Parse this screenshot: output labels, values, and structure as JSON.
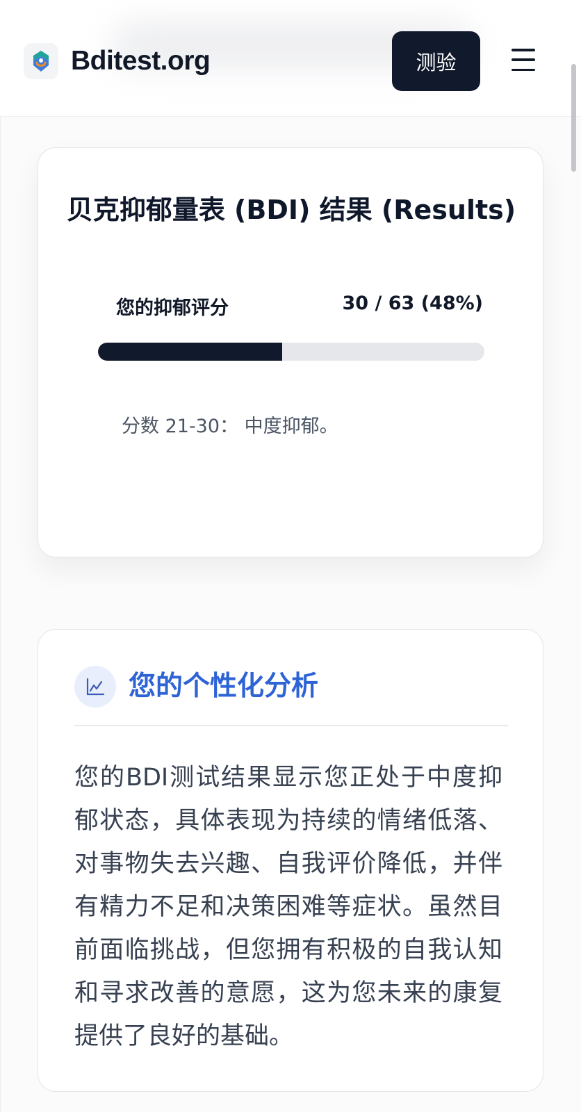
{
  "header": {
    "brand": "Bditest.org",
    "logo_icon": "brain-logo-icon",
    "test_button_label": "测验",
    "menu_icon": "hamburger-menu-icon"
  },
  "results": {
    "title": "贝克抑郁量表 (BDI) 结果 (Results)",
    "score_label": "您的抑郁评分",
    "score_text": "30 / 63 (48%)",
    "score": 30,
    "max_score": 63,
    "progress_fraction": 0.476,
    "description": "分数 21-30：  中度抑郁。"
  },
  "analysis": {
    "icon": "line-chart-icon",
    "title": "您的个性化分析",
    "body": "您的BDI测试结果显示您正处于中度抑郁状态，具体表现为持续的情绪低落、对事物失去兴趣、自我评价降低，并伴有精力不足和决策困难等症状。虽然目前面临挑战，但您拥有积极的自我认知和寻求改善的意愿，这为您未来的康复提供了良好的基础。"
  },
  "colors": {
    "primary_dark": "#111a2c",
    "accent_blue": "#2e63d6",
    "track_gray": "#e5e7eb"
  }
}
